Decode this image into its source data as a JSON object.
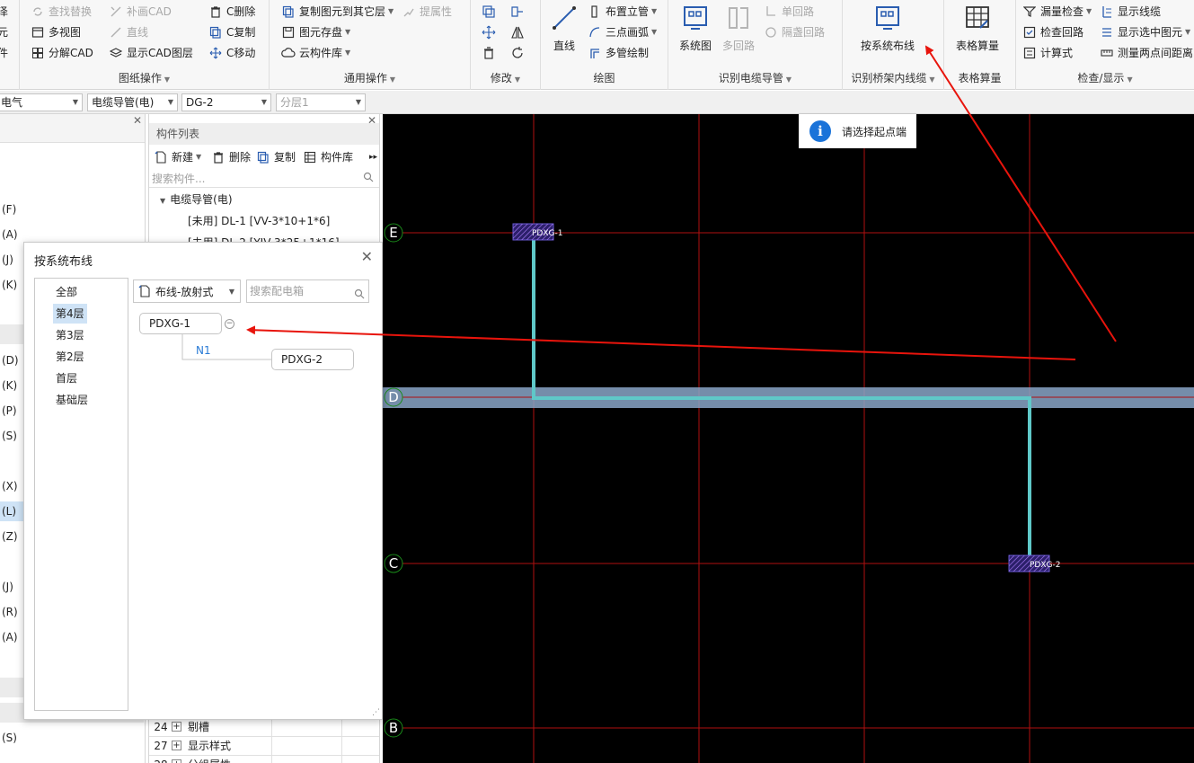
{
  "ribbon": {
    "groups": {
      "drawing_ops": "图纸操作",
      "common_ops": "通用操作",
      "modify": "修改",
      "draw": "绘图",
      "recognize_conduit": "识别电缆导管",
      "recognize_tray": "识别桥架内线缆",
      "table_calc": "表格算量",
      "check_display": "检查/显示"
    },
    "left_partial": {
      "row1": "泽",
      "row2": "元",
      "row3": "件"
    },
    "drawing_ops_items": {
      "find_replace": "查找替换",
      "fill_cad": "补画CAD",
      "c_delete": "C删除",
      "multiview": "多视图",
      "line": "直线",
      "c_copy": "C复制",
      "explode_cad": "分解CAD",
      "show_cad_layer": "显示CAD图层",
      "c_move": "C移动"
    },
    "common_ops_items": {
      "copy_to_layer": "复制图元到其它层",
      "extract_attr": "提属性",
      "element_save": "图元存盘",
      "cloud_lib": "云构件库"
    },
    "draw_items": {
      "straight": "直线",
      "riser": "布置立管",
      "three_point_arc": "三点画弧",
      "multi_pipe": "多管绘制"
    },
    "recognize_conduit_items": {
      "system_diagram": "系统图",
      "multi_loop": "多回路",
      "single_loop": "单回路",
      "covered_loop": "隔盏回路"
    },
    "recognize_tray_items": {
      "route_by_system": "按系统布线"
    },
    "table_calc_items": {
      "table_calc": "表格算量"
    },
    "check_items": {
      "leak_check": "漏量检查",
      "show_cable": "显示线缆",
      "check_loop": "检查回路",
      "show_selected": "显示选中图元",
      "calc_formula": "计算式",
      "measure_distance": "测量两点间距离"
    }
  },
  "selectors": {
    "discipline": "电气",
    "component_type": "电缆导管(电)",
    "component_name": "DG-2",
    "sub_layer": "分层1"
  },
  "left_panel": {
    "rows": [
      "(F)",
      "(A)",
      "(J)",
      "(K)",
      "(D)",
      "(K)",
      "(P)",
      "(S)",
      "(X)",
      "(L)",
      "(Z)",
      "(J)",
      "(R)",
      "(A)",
      "(S)"
    ]
  },
  "component_list": {
    "title": "构件列表",
    "new": "新建",
    "delete": "删除",
    "copy": "复制",
    "library": "构件库",
    "search_placeholder": "搜索构件...",
    "tree_root": "电缆导管(电)",
    "tree_item1": "[未用] DL-1 [VV-3*10+1*6]",
    "tree_item2": "[未用] DL-2 [YJV-3*25+1*16]",
    "table_rows": [
      {
        "num": "24",
        "label": "剔槽"
      },
      {
        "num": "27",
        "label": "显示样式"
      },
      {
        "num": "28",
        "label": "分组属性"
      }
    ]
  },
  "dialog": {
    "title": "按系统布线",
    "floors": [
      "全部",
      "第4层",
      "第3层",
      "第2层",
      "首层",
      "基础层"
    ],
    "selected_floor": "第4层",
    "mode": "布线-放射式",
    "search_placeholder": "搜索配电箱",
    "node_root": "PDXG-1",
    "node_child": "PDXG-2",
    "link_label": "N1"
  },
  "tooltip": {
    "text": "请选择起点端"
  },
  "canvas": {
    "axis_labels": {
      "E": "E",
      "D": "D",
      "C": "C",
      "B": "B"
    },
    "box1": "PDXG-1",
    "box2": "PDXG-2"
  },
  "colors": {
    "grid": "#b01010",
    "route": "#5fc8c8",
    "highlight_band": "#8aa6c8",
    "annotation_arrow": "#e8140c",
    "accent": "#1a73d9"
  }
}
